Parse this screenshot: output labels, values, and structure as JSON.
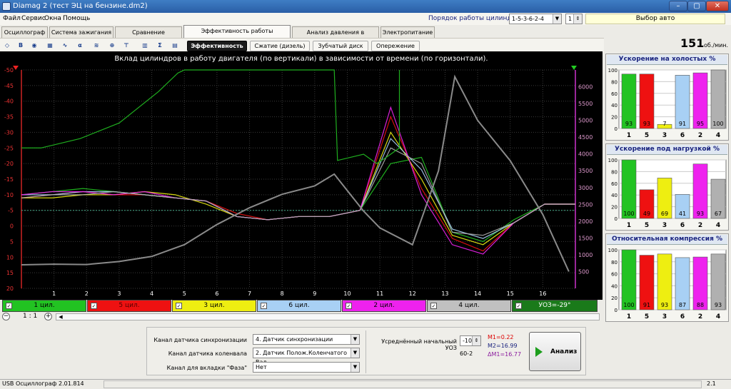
{
  "window": {
    "title": "Diamag 2 (тест ЭЦ на бензине.dm2)",
    "min": "–",
    "max": "▢",
    "close": "✕"
  },
  "menu": [
    "Файл",
    "Сервис",
    "Окна",
    "Помощь"
  ],
  "cyl_order": {
    "label": "Порядок работы цилиндров",
    "value": "1-5-3-6-2-4",
    "spin_value": "1"
  },
  "auto_select": "Выбор авто",
  "tabs": [
    "Осциллограф",
    "Система зажигания",
    "Сравнение цилиндров",
    "Эффективность работы цилиндров",
    "Анализ давления в цилиндре",
    "Электропитание"
  ],
  "toolbar_icons": [
    "scale-icon",
    "b-icon",
    "rpm-icon",
    "filter-icon",
    "wave-icon",
    "alpha-icon",
    "multi-icon",
    "zoom-icon",
    "cursor-icon",
    "bars-icon",
    "sum-icon",
    "chart-icon"
  ],
  "subtabs": [
    "Эффективность",
    "Сжатие (дизель)",
    "Зубчатый диск",
    "Опережение"
  ],
  "rpm": {
    "value": "151",
    "unit": "об./мин."
  },
  "colors": {
    "cyl1": "#22c322",
    "cyl5": "#ee1111",
    "cyl3": "#eeee11",
    "cyl6": "#a8d0f4",
    "cyl2": "#ee22ee",
    "cyl4": "#b0b0b0",
    "uoz": "#1a7a1a",
    "rpm_line": "#8a8a8a"
  },
  "chart_data": {
    "type": "line",
    "title": "Вклад цилиндров в работу двигателя (по вертикали) в зависимости от времени (по горизонтали).",
    "x_ticks": [
      1,
      2,
      3,
      4,
      5,
      6,
      7,
      8,
      9,
      10,
      11,
      12,
      13,
      14,
      15,
      16
    ],
    "xlim": [
      0,
      17
    ],
    "y_left_ticks": [
      -50,
      -45,
      -40,
      -35,
      -30,
      -25,
      -20,
      -15,
      -10,
      -5,
      0,
      5,
      10,
      15,
      20
    ],
    "ylim_left": [
      -50,
      20
    ],
    "y_right_ticks": [
      500,
      1000,
      1500,
      2000,
      2500,
      3000,
      3500,
      4000,
      4500,
      5000,
      5500,
      6000
    ],
    "ylim_right": [
      0,
      6500
    ],
    "series": [
      {
        "name": "1 цил.",
        "values": [
          -10,
          -11,
          -12,
          -11,
          -10,
          -9,
          -8,
          -3,
          -2,
          -3,
          -3,
          -5,
          -20,
          -22,
          2,
          5,
          -2,
          -7,
          -7
        ]
      },
      {
        "name": "5 цил.",
        "values": [
          -9,
          -10,
          -11,
          -10,
          -10,
          -9,
          -8,
          -4,
          -2,
          -3,
          -3,
          -5,
          -35,
          -12,
          4,
          8,
          -1,
          -7,
          -7
        ]
      },
      {
        "name": "3 цил.",
        "values": [
          -9,
          -9,
          -10,
          -10,
          -11,
          -10,
          -7,
          -3,
          -2,
          -3,
          -3,
          -5,
          -30,
          -15,
          3,
          6,
          -1,
          -7,
          -7
        ]
      },
      {
        "name": "6 цил.",
        "values": [
          -10,
          -10,
          -11,
          -11,
          -10,
          -9,
          -8,
          -3,
          -2,
          -3,
          -3,
          -5,
          -28,
          -18,
          1,
          4,
          -1,
          -7,
          -7
        ]
      },
      {
        "name": "2 цил.",
        "values": [
          -10,
          -11,
          -11,
          -10,
          -11,
          -9,
          -8,
          -3,
          -2,
          -3,
          -3,
          -5,
          -38,
          -10,
          6,
          9,
          -1,
          -7,
          -7
        ]
      },
      {
        "name": "4 цил.",
        "values": [
          -9,
          -10,
          -10,
          -11,
          -10,
          -9,
          -8,
          -3,
          -2,
          -3,
          -3,
          -5,
          -25,
          -20,
          2,
          3,
          -1,
          -7,
          -7
        ]
      },
      {
        "name": "УОЗ=-29°",
        "x": [
          0,
          0.6,
          1.8,
          3.0,
          4.2,
          4.8,
          5.0,
          9.3,
          9.6,
          9.7,
          10.5,
          10.9,
          11.2,
          11.6,
          11.6
        ],
        "values": [
          -25,
          -25,
          -28,
          -33,
          -43,
          -49,
          -50,
          -50,
          -50,
          -21,
          -23,
          -20,
          -22,
          -25,
          -50
        ]
      },
      {
        "name": "rpm",
        "x": [
          0,
          1,
          2,
          3,
          4,
          5,
          6,
          7,
          8,
          9,
          9.6,
          10.5,
          11,
          12,
          12.8,
          13.3,
          14,
          15,
          16,
          16.8
        ],
        "values": [
          700,
          720,
          710,
          800,
          950,
          1300,
          1900,
          2400,
          2800,
          3050,
          3400,
          2300,
          1800,
          1300,
          3500,
          6300,
          5000,
          3800,
          2200,
          500
        ]
      }
    ]
  },
  "legend": [
    {
      "label": "1 цил.",
      "checked": "✓"
    },
    {
      "label": "5 цил.",
      "checked": "✓"
    },
    {
      "label": "3 цил.",
      "checked": "✓"
    },
    {
      "label": "6 цил.",
      "checked": "✓"
    },
    {
      "label": "2 цил.",
      "checked": "✓"
    },
    {
      "label": "4 цил.",
      "checked": "✓"
    },
    {
      "label": "УОЗ=-29°",
      "checked": "✓"
    }
  ],
  "zoom": {
    "value": "1 : 1",
    "minus": "−",
    "plus": "+"
  },
  "bottom": {
    "sync_label": "Канал датчика синхронизации",
    "sync_value": "4. Датчик синхронизации",
    "crank_label": "Канал датчика коленвала",
    "crank_value": "2. Датчик Полож.Коленчатого Вал",
    "phase_label": "Канал для вкладки \"Фаза\"",
    "phase_value": "Нет",
    "uoz_label": "Усреднённый начальный УОЗ",
    "uoz_value": "-10",
    "teeth": "60-2",
    "m1": "M1=0.22",
    "m2": "M2=16.99",
    "dm": "ΔM1=16.77",
    "analysis": "Анализ"
  },
  "panels": [
    {
      "title": "Ускорение на холостых %",
      "cyls": [
        "1",
        "5",
        "3",
        "6",
        "2",
        "4"
      ],
      "values": [
        93,
        93,
        7,
        91,
        95,
        100
      ]
    },
    {
      "title": "Ускорение под нагрузкой %",
      "cyls": [
        "1",
        "5",
        "3",
        "6",
        "2",
        "4"
      ],
      "values": [
        100,
        49,
        69,
        41,
        93,
        67
      ]
    },
    {
      "title": "Относительная компрессия %",
      "cyls": [
        "1",
        "5",
        "3",
        "6",
        "2",
        "4"
      ],
      "values": [
        100,
        91,
        93,
        87,
        88,
        93
      ]
    }
  ],
  "panel_ticks": [
    "0",
    "20",
    "40",
    "60",
    "80",
    "100"
  ],
  "status": {
    "left": "USB Осциллограф  2.01.814",
    "right": "2.1"
  }
}
